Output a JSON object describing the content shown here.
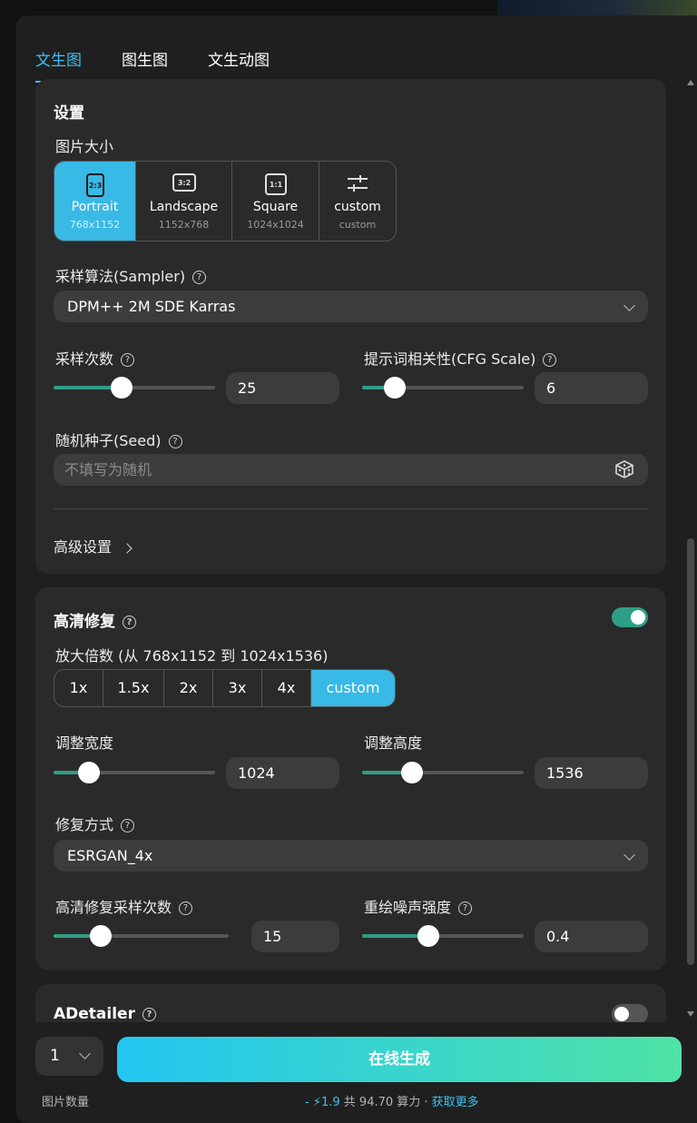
{
  "tabs": [
    "文生图",
    "图生图",
    "文生动图"
  ],
  "settings": {
    "title": "设置",
    "image_size_label": "图片大小",
    "sizes": [
      {
        "icon_text": "2:3",
        "name": "Portrait",
        "dims": "768x1152"
      },
      {
        "icon_text": "3:2",
        "name": "Landscape",
        "dims": "1152x768"
      },
      {
        "icon_text": "1:1",
        "name": "Square",
        "dims": "1024x1024"
      },
      {
        "icon": "sliders-icon",
        "name": "custom",
        "dims": "custom"
      }
    ],
    "selected_size": "Portrait",
    "sampler_label": "采样算法(Sampler)",
    "sampler_value": "DPM++ 2M SDE Karras",
    "steps_label": "采样次数",
    "steps_value": "25",
    "steps_fraction": 0.42,
    "cfg_label": "提示词相关性(CFG Scale)",
    "cfg_value": "6",
    "cfg_fraction": 0.2,
    "seed_label": "随机种子(Seed)",
    "seed_placeholder": "不填写为随机",
    "advanced_label": "高级设置"
  },
  "hires": {
    "title": "高清修复",
    "enabled": true,
    "scale_label": "放大倍数 (从 768x1152 到 1024x1536)",
    "scale_options": [
      "1x",
      "1.5x",
      "2x",
      "3x",
      "4x",
      "custom"
    ],
    "selected_scale": "custom",
    "width_label": "调整宽度",
    "width_value": "1024",
    "width_fraction": 0.22,
    "height_label": "调整高度",
    "height_value": "1536",
    "height_fraction": 0.31,
    "method_label": "修复方式",
    "method_value": "ESRGAN_4x",
    "hires_steps_label": "高清修复采样次数",
    "hires_steps_value": "15",
    "hires_steps_fraction": 0.27,
    "denoise_label": "重绘噪声强度",
    "denoise_value": "0.4",
    "denoise_fraction": 0.41
  },
  "adetailer": {
    "title": "ADetailer",
    "enabled": false
  },
  "footer": {
    "count_value": "1",
    "count_label": "图片数量",
    "generate_label": "在线生成",
    "cost_prefix": "- ",
    "cost_amount": "1.9",
    "cost_total": " 共 94.70 算力 · ",
    "get_more": "获取更多"
  },
  "colors": {
    "accent": "#38b9e6",
    "slider_green": "#2f9e86",
    "card_bg": "#2a2a2a"
  }
}
